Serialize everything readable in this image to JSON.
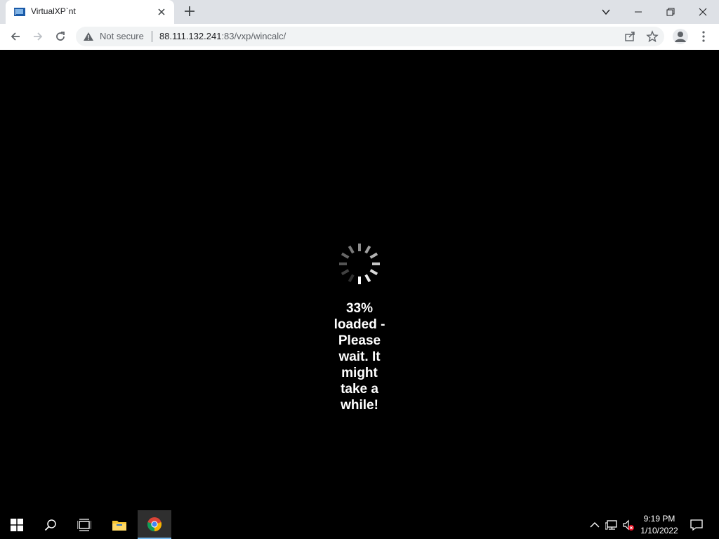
{
  "browser": {
    "tab": {
      "title": "VirtualXP`nt",
      "close_icon": "close-icon",
      "favicon": "virtualxp-favicon"
    },
    "new_tab_icon": "plus-icon",
    "window_controls": [
      "chevron-down-icon",
      "minimize-icon",
      "restore-icon",
      "close-icon"
    ],
    "security": {
      "icon": "warning-triangle-icon",
      "label": "Not secure"
    },
    "url": {
      "host": "88.111.132.241",
      "rest": ":83/vxp/wincalc/"
    },
    "toolbar_icons": [
      "back-arrow-icon",
      "forward-arrow-icon",
      "reload-icon",
      "share-icon",
      "star-icon",
      "profile-icon",
      "kebab-menu-icon"
    ]
  },
  "page": {
    "progress_percent": 33,
    "loading_text": "33% loaded - Please wait. It might take a while!"
  },
  "taskbar": {
    "apps": [
      "windows-start-icon",
      "search-icon",
      "task-view-icon",
      "file-explorer-icon",
      "chrome-icon"
    ],
    "active_app": "chrome-icon",
    "tray_icons": [
      "chevron-up-icon",
      "network-icon",
      "speaker-muted-icon",
      "notification-icon"
    ],
    "time": "9:19 PM",
    "date": "1/10/2022"
  },
  "colors": {
    "accent": "#76b9ed",
    "chrome_bg": "#dee1e6",
    "page_bg": "#000000"
  }
}
